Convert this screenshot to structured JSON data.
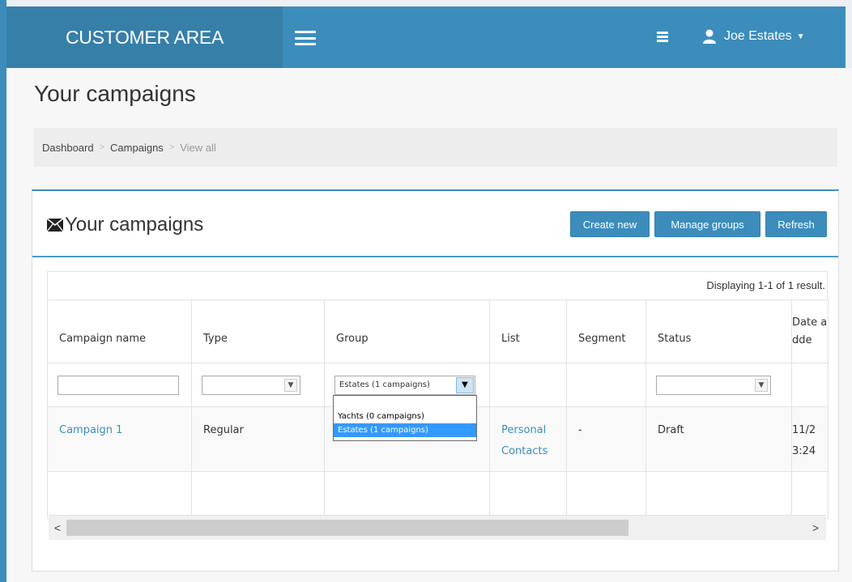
{
  "topbar": {
    "brand": "CUSTOMER AREA",
    "user_name": "Joe Estates"
  },
  "page": {
    "title": "Your campaigns",
    "breadcrumb": [
      "Dashboard",
      "Campaigns",
      "View all"
    ]
  },
  "box": {
    "title": "Your campaigns",
    "buttons": {
      "create": "Create new",
      "manage_groups": "Manage groups",
      "refresh": "Refresh"
    },
    "summary": "Displaying 1-1 of 1 result."
  },
  "table": {
    "columns": [
      "Campaign name",
      "Type",
      "Group",
      "List",
      "Segment",
      "Status",
      "Date adde"
    ],
    "filters": {
      "group_value": "Estates (1 campaigns)"
    },
    "group_options": [
      "Yachts (0 campaigns)",
      "Estates (1 campaigns)"
    ],
    "rows": [
      {
        "name": "Campaign 1",
        "type": "Regular",
        "list_line1": "Personal",
        "list_line2": "Contacts",
        "segment": "-",
        "status": "Draft",
        "date_line1": "11/2",
        "date_line2": "3:24"
      }
    ]
  },
  "colors": {
    "brand_blue": "#3c8dbc",
    "brand_dark": "#367fa9",
    "selected_option": "#3399ff"
  },
  "icons": [
    "hamburger-menu-icon",
    "notifications-icon",
    "user-icon",
    "caret-down-icon",
    "envelope-icon",
    "chevron-down-icon",
    "scroll-left-icon",
    "scroll-right-icon"
  ]
}
